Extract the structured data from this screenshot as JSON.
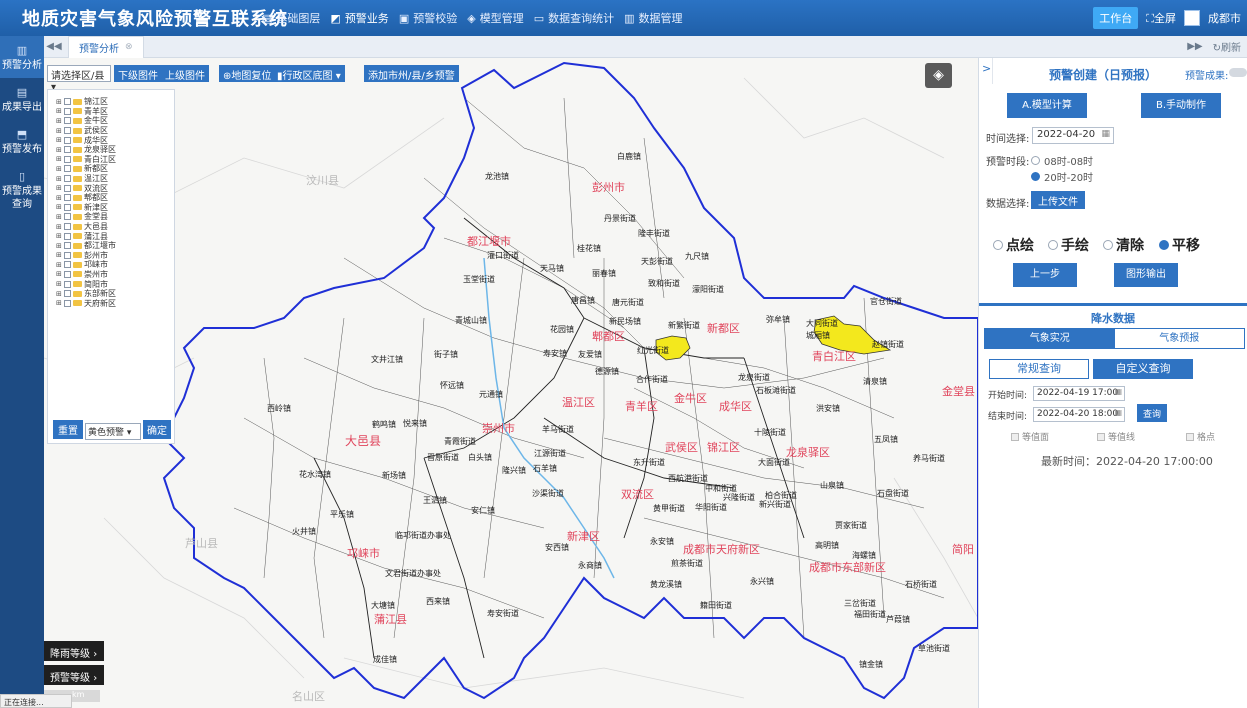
{
  "app": {
    "title": "地质灾害气象风险预警互联系统",
    "nav": [
      {
        "label": "基础图层",
        "icon": "layers-icon"
      },
      {
        "label": "预警业务",
        "icon": "chart-icon",
        "active": true
      },
      {
        "label": "预警校验",
        "icon": "document-icon"
      },
      {
        "label": "模型管理",
        "icon": "settings-icon"
      },
      {
        "label": "数据查询统计",
        "icon": "monitor-icon"
      },
      {
        "label": "数据管理",
        "icon": "database-icon"
      }
    ],
    "workbench": "工作台",
    "fullscreen": "全屏",
    "user": "成都市"
  },
  "sidebar": {
    "items": [
      {
        "label": "预警分析",
        "icon": "analysis-icon",
        "active": true
      },
      {
        "label": "成果导出",
        "icon": "export-icon"
      },
      {
        "label": "预警发布",
        "icon": "publish-icon"
      },
      {
        "label": "预警成果查询",
        "icon": "query-icon"
      }
    ]
  },
  "tabs": {
    "active": "预警分析",
    "refresh": "刷新"
  },
  "map_toolbar": {
    "district_select": "请选择区/县",
    "lower_layer": "下级图件",
    "upper_layer": "上级图件",
    "map_reset": "地图复位",
    "admin_basemap": "行政区底图",
    "add_warning": "添加市州/县/乡预警"
  },
  "tree": {
    "items": [
      "锦江区",
      "青羊区",
      "金牛区",
      "武侯区",
      "成华区",
      "龙泉驿区",
      "青白江区",
      "新都区",
      "温江区",
      "双流区",
      "郫都区",
      "新津区",
      "金堂县",
      "大邑县",
      "蒲江县",
      "都江堰市",
      "彭州市",
      "邛崃市",
      "崇州市",
      "简阳市",
      "东部新区",
      "天府新区"
    ],
    "reset": "重置",
    "level": "黄色预警",
    "confirm": "确定"
  },
  "map_labels": {
    "districts": [
      "彭州市",
      "都江堰市",
      "郫都区",
      "新都区",
      "青白江区",
      "金牛区",
      "成华区",
      "青羊区",
      "温江区",
      "崇州市",
      "武侯区",
      "锦江区",
      "龙泉驿区",
      "大邑县",
      "双流区",
      "新津区",
      "邛崃市",
      "成都市天府新区",
      "成都市东部新区",
      "蒲江县",
      "金堂县",
      "简阳"
    ],
    "towns": [
      "白鹿镇",
      "龙池镇",
      "丹景街道",
      "隆丰街道",
      "桂花镇",
      "天马镇",
      "丽春镇",
      "天彭街道",
      "九尺镇",
      "致和街道",
      "濛阳街道",
      "灌口街道",
      "玉堂街道",
      "唐昌镇",
      "唐元街道",
      "青城山镇",
      "花园镇",
      "新民场镇",
      "新繁街道",
      "红光街道",
      "寿安镇",
      "友爱镇",
      "德源镇",
      "合作街道",
      "文井江镇",
      "街子镇",
      "怀远镇",
      "元通镇",
      "西岭镇",
      "鹤鸣镇",
      "悦来镇",
      "青霞街道",
      "晋原街道",
      "白头镇",
      "羊马街道",
      "江源街道",
      "隆兴镇",
      "王泗镇",
      "沙渠街道",
      "安仁镇",
      "花水湾镇",
      "新场镇",
      "平乐镇",
      "火井镇",
      "临邛街道办事处",
      "文君街道办事处",
      "安西镇",
      "永商镇",
      "西来镇",
      "大塘镇",
      "寿安街道",
      "成佳镇",
      "官仓街道",
      "大同街道",
      "弥牟镇",
      "城厢镇",
      "赵镇街道",
      "清泉镇",
      "五凤镇",
      "龙泉街道",
      "洪安镇",
      "石板滩街道",
      "十陵街道",
      "山泉镇",
      "高明镇",
      "贾家街道",
      "海螺镇",
      "石盘街道",
      "三岔街道",
      "石桥街道",
      "镇金镇",
      "永安镇",
      "黄龙溪镇",
      "籍田街道",
      "兴隆街道",
      "煎茶街道",
      "华阳街道",
      "黄甲街道",
      "西航港街道",
      "东升街道",
      "中和街道",
      "柏合街道",
      "大面街道",
      "石羊镇",
      "永兴镇",
      "福田街道",
      "芦葭镇",
      "草池街道",
      "养马街道",
      "新兴街道"
    ],
    "grey": [
      "汶川县",
      "芦山县",
      "名山区"
    ]
  },
  "legend": {
    "rain_level": "降雨等级",
    "warning_level": "预警等级",
    "scale": "km"
  },
  "status": "正在连接...",
  "right_panel": {
    "title": "预警创建（日预报）",
    "result_label": "预警成果:",
    "model_calc": "A.模型计算",
    "manual": "B.手动制作",
    "time_label": "时间选择:",
    "date": "2022-04-20",
    "period_label": "预警时段:",
    "period_options": [
      "08时-08时",
      "20时-20时"
    ],
    "period_selected": 1,
    "data_label": "数据选择:",
    "upload": "上传文件",
    "draw_modes": [
      "点绘",
      "手绘",
      "清除",
      "平移"
    ],
    "draw_selected": 3,
    "prev_step": "上一步",
    "export_graph": "图形输出",
    "rain_title": "降水数据",
    "rain_tabs": [
      "气象实况",
      "气象预报"
    ],
    "rain_tab_active": 0,
    "query_tabs": [
      "常规查询",
      "自定义查询"
    ],
    "query_tab_active": 1,
    "start_label": "开始时间:",
    "start_time": "2022-04-19 17:00",
    "end_label": "结束时间:",
    "end_time": "2022-04-20 18:00",
    "query_btn": "查询",
    "checks": [
      "等值面",
      "等值线",
      "格点"
    ],
    "latest_time": "最新时间：2022-04-20 17:00:00"
  },
  "colors": {
    "top_bar": "#2b73c4",
    "sidebar": "#1d4b83",
    "accent": "#2f73c2",
    "boundary": "#1f2fd6",
    "warning_fill": "#f3e81d",
    "district_label": "#e0445b"
  }
}
